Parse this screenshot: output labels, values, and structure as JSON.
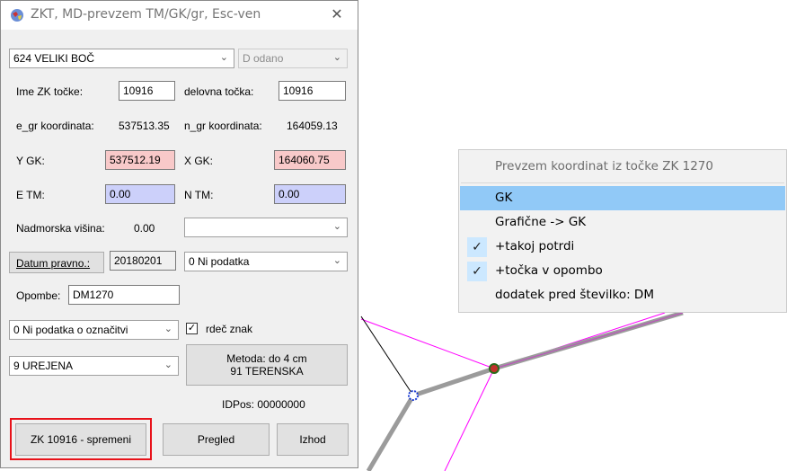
{
  "dialog": {
    "title": "ZKT, MD-prevzem TM/GK/gr, Esc-ven",
    "close_glyph": "✕",
    "app_icon": "app-globe-icon",
    "cadastre_combo": "624 VELIKI BOČ",
    "status_combo": "D odano",
    "ime_label": "Ime ZK točke:",
    "ime_value": "10916",
    "delovna_label": "delovna točka:",
    "delovna_value": "10916",
    "egr_label": "e_gr koordinata:",
    "egr_value": "537513.35",
    "ngr_label": "n_gr koordinata:",
    "ngr_value": "164059.13",
    "ygk_label": "Y GK:",
    "ygk_value": "537512.19",
    "xgk_label": "X GK:",
    "xgk_value": "164060.75",
    "etm_label": "E TM:",
    "etm_value": "0.00",
    "ntm_label": "N TM:",
    "ntm_value": "0.00",
    "nadm_label": "Nadmorska višina:",
    "nadm_value": "0.00",
    "nadm_combo": "",
    "datum_button": "Datum pravno.:",
    "datum_value": "20180201",
    "datum_combo": "0 Ni podatka",
    "opombe_label": "Opombe:",
    "opombe_value": "DM1270",
    "oznacitev_combo": "0 Ni podatka o označitvi",
    "rdec_label": "rdeč znak",
    "rdec_checked": true,
    "urejena_combo": "9 UREJENA",
    "metoda_line1": "Metoda: do 4 cm",
    "metoda_line2": "91 TERENSKA",
    "idpos": "IDPos: 00000000",
    "spremeni_button": "ZK 10916 - spremeni",
    "pregled_button": "Pregled",
    "izhod_button": "Izhod",
    "field_red": "#f8c9c9",
    "field_blue": "#ccd0fa",
    "highlight_border": "#e8121a"
  },
  "menu": {
    "header": "Prevzem koordinat iz točke ZK 1270",
    "items": [
      {
        "label": "GK",
        "checked": false,
        "highlighted": true
      },
      {
        "label": "Grafične -> GK",
        "checked": false,
        "highlighted": false
      },
      {
        "label": "+takoj potrdi",
        "checked": true,
        "highlighted": false
      },
      {
        "label": "+točka v opombo",
        "checked": true,
        "highlighted": false
      },
      {
        "label": "dodatek pred številko: DM",
        "checked": false,
        "highlighted": false
      }
    ],
    "check_glyph": "✓",
    "highlight_color": "#91c9f7"
  }
}
